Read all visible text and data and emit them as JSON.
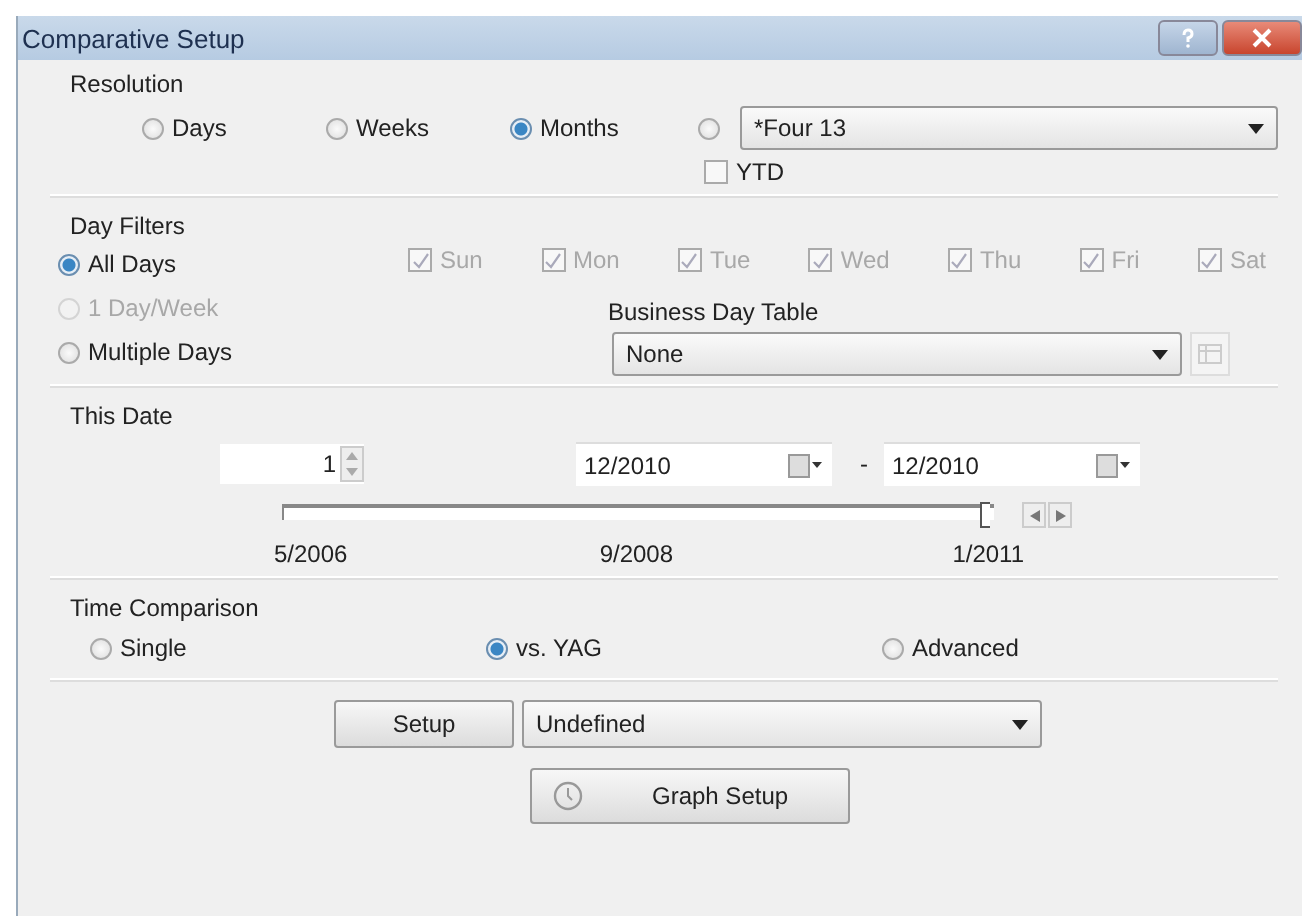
{
  "window": {
    "title": "Comparative Setup"
  },
  "resolution": {
    "label": "Resolution",
    "options": [
      {
        "label": "Days",
        "selected": false
      },
      {
        "label": "Weeks",
        "selected": false
      },
      {
        "label": "Months",
        "selected": true
      }
    ],
    "custom": {
      "selected": false,
      "value": "*Four 13"
    },
    "ytd": {
      "label": "YTD",
      "checked": false
    }
  },
  "day_filters": {
    "label": "Day Filters",
    "modes": [
      {
        "label": "All Days",
        "selected": true,
        "disabled": false
      },
      {
        "label": "1 Day/Week",
        "selected": false,
        "disabled": true
      },
      {
        "label": "Multiple Days",
        "selected": false,
        "disabled": false
      }
    ],
    "days": [
      {
        "label": "Sun",
        "checked": true,
        "disabled": true
      },
      {
        "label": "Mon",
        "checked": true,
        "disabled": true
      },
      {
        "label": "Tue",
        "checked": true,
        "disabled": true
      },
      {
        "label": "Wed",
        "checked": true,
        "disabled": true
      },
      {
        "label": "Thu",
        "checked": true,
        "disabled": true
      },
      {
        "label": "Fri",
        "checked": true,
        "disabled": true
      },
      {
        "label": "Sat",
        "checked": true,
        "disabled": true
      }
    ],
    "business_day_table": {
      "label": "Business Day Table",
      "value": "None"
    }
  },
  "this_date": {
    "label": "This Date",
    "count": "1",
    "from": "12/2010",
    "separator": "-",
    "to": "12/2010",
    "slider": {
      "level": 0.98
    },
    "ticks": [
      "5/2006",
      "9/2008",
      "1/2011"
    ]
  },
  "time_comparison": {
    "label": "Time Comparison",
    "options": [
      {
        "label": "Single",
        "selected": false
      },
      {
        "label": "vs. YAG",
        "selected": true
      },
      {
        "label": "Advanced",
        "selected": false
      }
    ]
  },
  "setup": {
    "button": "Setup",
    "value": "Undefined"
  },
  "graph_setup": {
    "button": "Graph Setup"
  }
}
